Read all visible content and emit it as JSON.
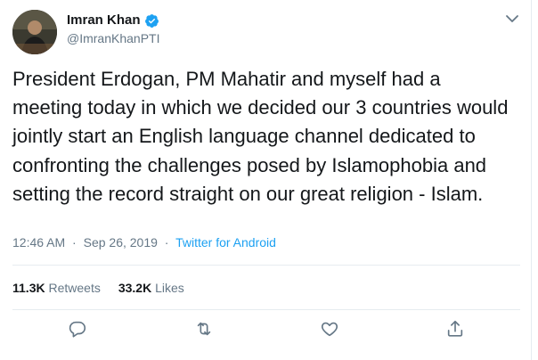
{
  "tweet": {
    "author": {
      "name": "Imran Khan",
      "handle": "@ImranKhanPTI",
      "verified": true
    },
    "text": "President Erdogan, PM Mahatir and myself had a meeting today in which we decided our 3 countries would jointly start an English language channel dedicated to confronting the challenges posed by Islamophobia and setting the record straight on our great religion - Islam.",
    "time": "12:46 AM",
    "separator": "·",
    "date": "Sep 26, 2019",
    "source": "Twitter for Android",
    "stats": {
      "retweets_count": "11.3K",
      "retweets_label": "Retweets",
      "likes_count": "33.2K",
      "likes_label": "Likes"
    },
    "actions": [
      "reply-icon",
      "retweet-icon",
      "like-icon",
      "share-icon"
    ]
  },
  "colors": {
    "text": "#14171a",
    "secondary": "#657786",
    "accent": "#1da1f2",
    "divider": "#e6ecf0"
  }
}
